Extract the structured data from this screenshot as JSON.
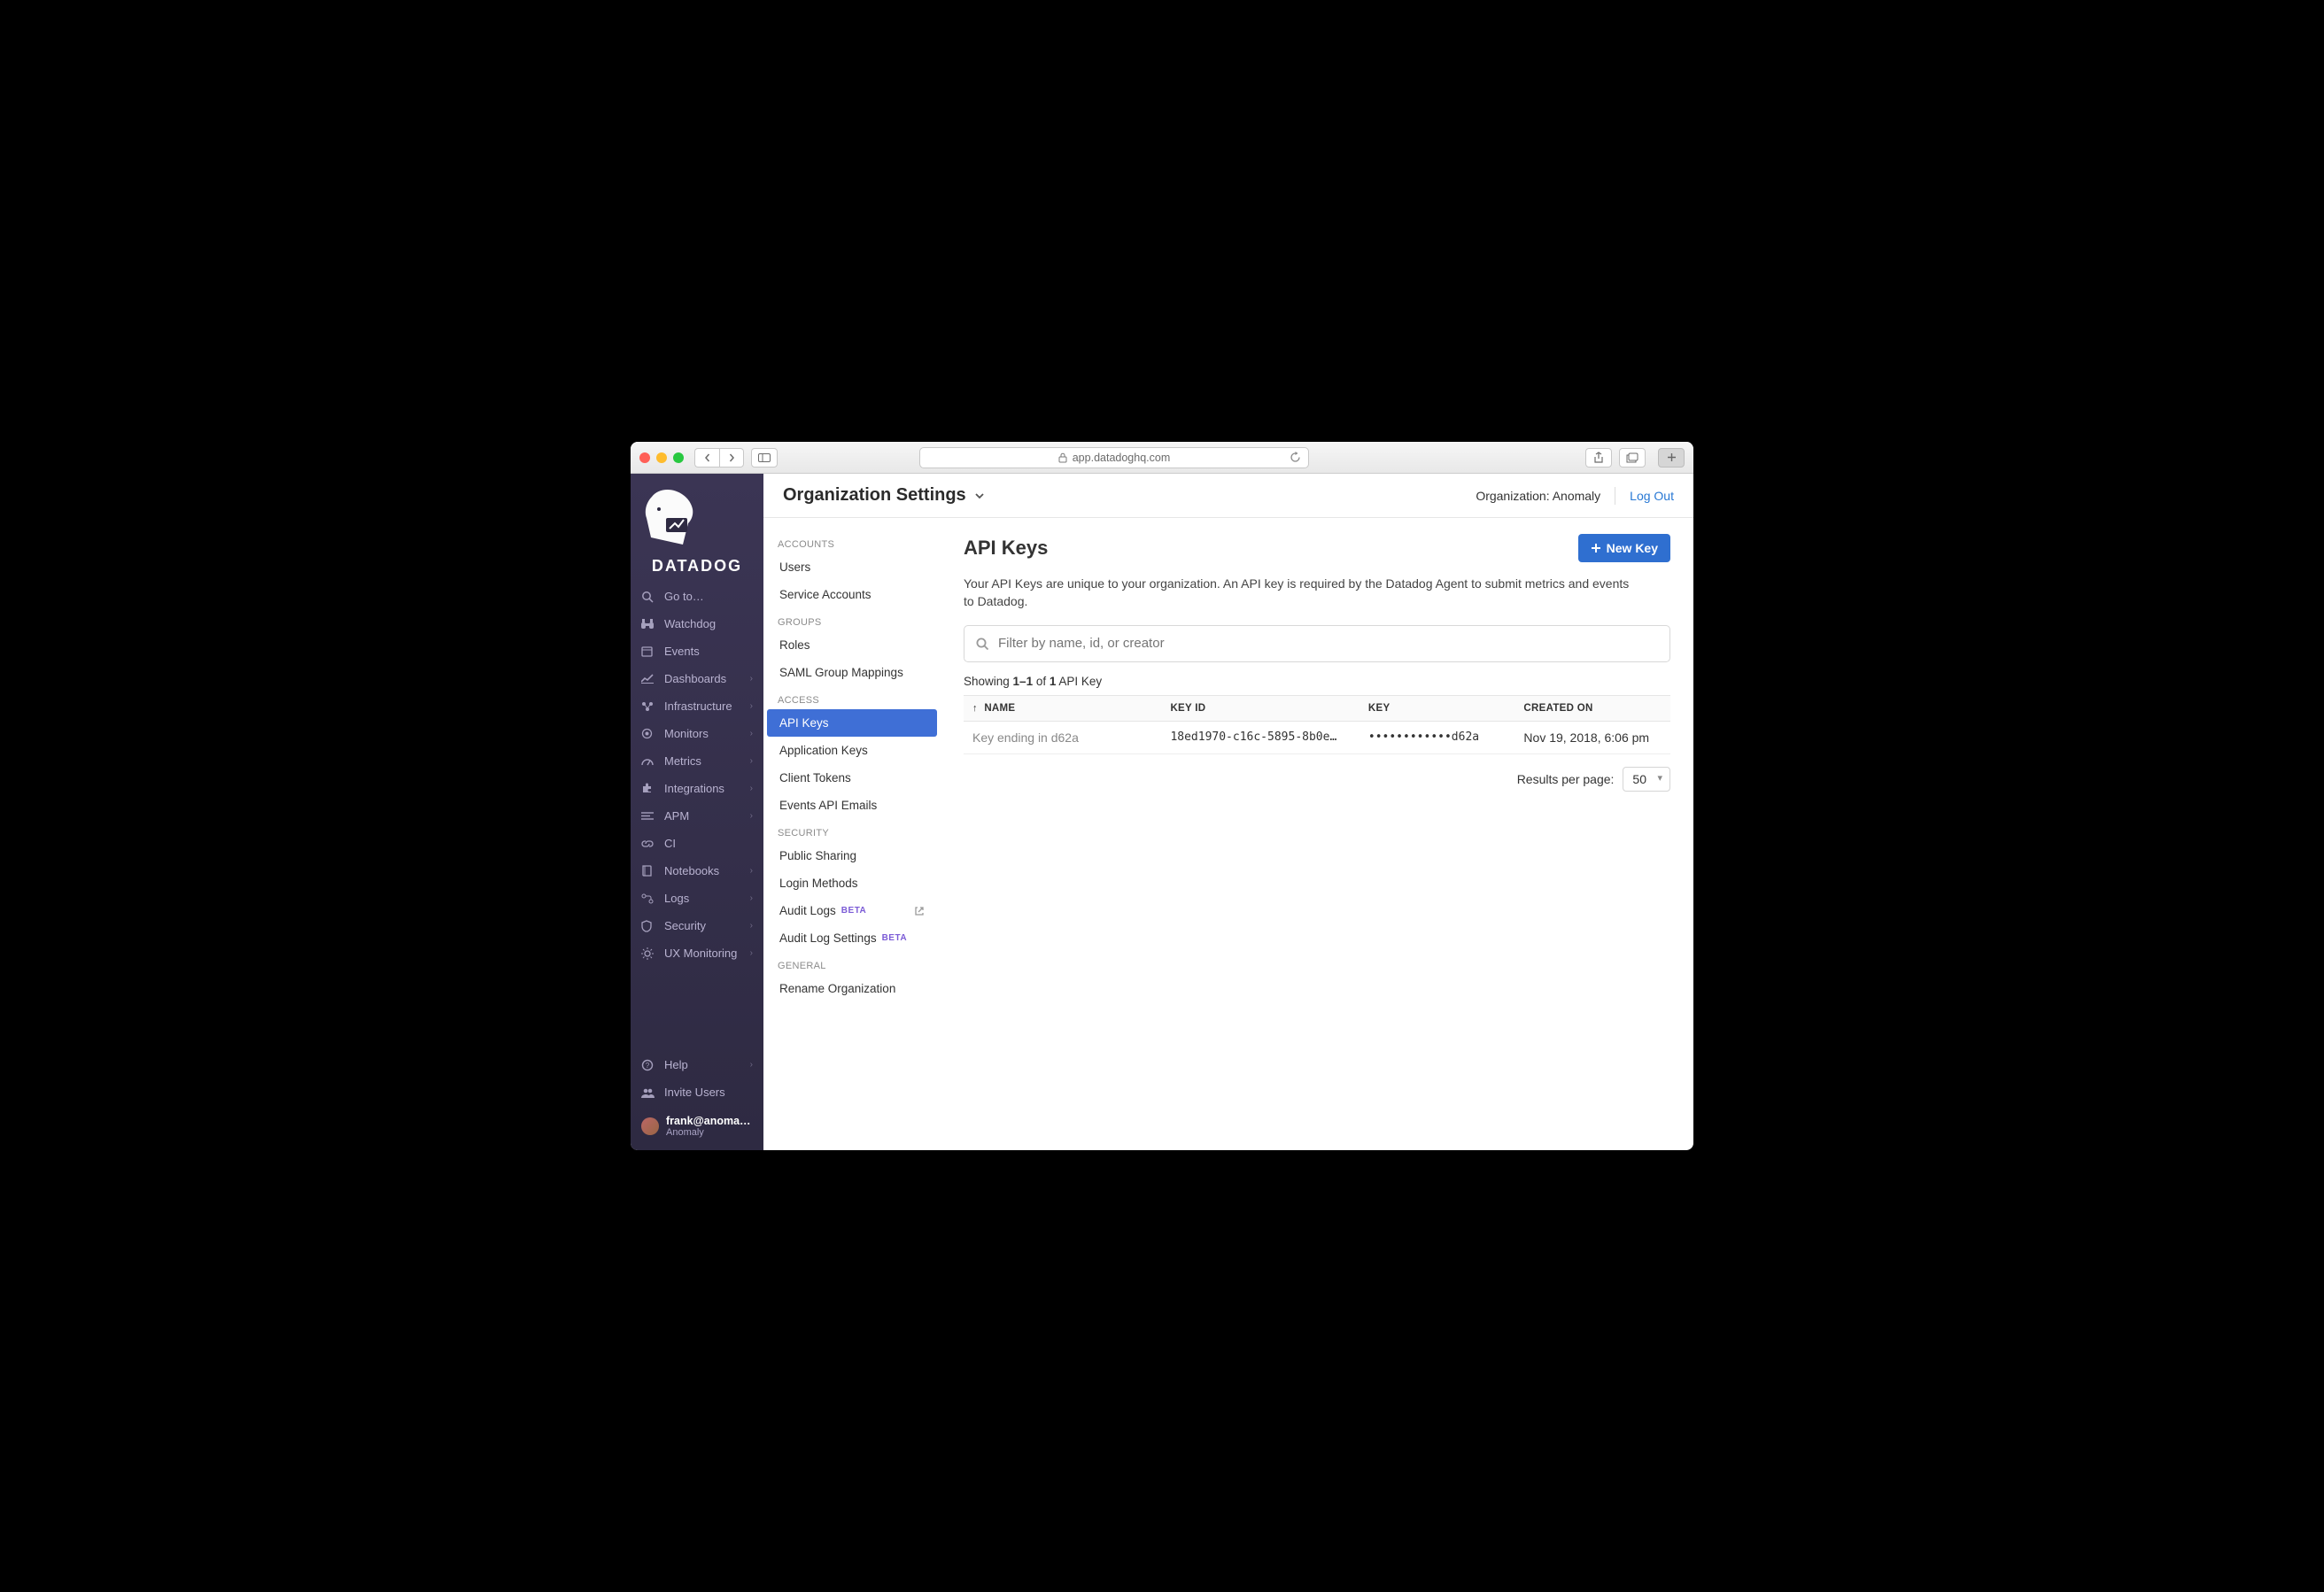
{
  "browser": {
    "url_host": "app.datadoghq.com"
  },
  "brand": "DATADOG",
  "leftnav": {
    "goto": "Go to…",
    "items": [
      {
        "icon": "binoculars",
        "label": "Watchdog",
        "chev": false
      },
      {
        "icon": "calendar",
        "label": "Events",
        "chev": false
      },
      {
        "icon": "chart",
        "label": "Dashboards",
        "chev": true
      },
      {
        "icon": "nodes",
        "label": "Infrastructure",
        "chev": true
      },
      {
        "icon": "target",
        "label": "Monitors",
        "chev": true
      },
      {
        "icon": "gauge",
        "label": "Metrics",
        "chev": true
      },
      {
        "icon": "puzzle",
        "label": "Integrations",
        "chev": true
      },
      {
        "icon": "lines",
        "label": "APM",
        "chev": true
      },
      {
        "icon": "link",
        "label": "CI",
        "chev": false
      },
      {
        "icon": "book",
        "label": "Notebooks",
        "chev": true
      },
      {
        "icon": "flow",
        "label": "Logs",
        "chev": true
      },
      {
        "icon": "shield",
        "label": "Security",
        "chev": true
      },
      {
        "icon": "ux",
        "label": "UX Monitoring",
        "chev": true
      }
    ],
    "help": "Help",
    "invite": "Invite Users",
    "user_email": "frank@anoma…",
    "user_org": "Anomaly"
  },
  "header": {
    "title": "Organization Settings",
    "org_label": "Organization: Anomaly",
    "logout": "Log Out"
  },
  "subnav": {
    "groups": [
      {
        "title": "ACCOUNTS",
        "items": [
          {
            "label": "Users"
          },
          {
            "label": "Service Accounts"
          }
        ]
      },
      {
        "title": "GROUPS",
        "items": [
          {
            "label": "Roles"
          },
          {
            "label": "SAML Group Mappings"
          }
        ]
      },
      {
        "title": "ACCESS",
        "items": [
          {
            "label": "API Keys",
            "active": true
          },
          {
            "label": "Application Keys"
          },
          {
            "label": "Client Tokens"
          },
          {
            "label": "Events API Emails"
          }
        ]
      },
      {
        "title": "SECURITY",
        "items": [
          {
            "label": "Public Sharing"
          },
          {
            "label": "Login Methods"
          },
          {
            "label": "Audit Logs",
            "badge": "BETA",
            "external": true
          },
          {
            "label": "Audit Log Settings",
            "badge": "BETA"
          }
        ]
      },
      {
        "title": "GENERAL",
        "items": [
          {
            "label": "Rename Organization"
          }
        ]
      }
    ]
  },
  "main": {
    "title": "API Keys",
    "new_button": "New Key",
    "description": "Your API Keys are unique to your organization. An API key is required by the Datadog Agent to submit metrics and events to Datadog.",
    "filter_placeholder": "Filter by name, id, or creator",
    "showing_prefix": "Showing ",
    "showing_range": "1–1",
    "showing_mid": " of ",
    "showing_total": "1",
    "showing_suffix": " API Key",
    "columns": {
      "name": "NAME",
      "key_id": "KEY ID",
      "key": "KEY",
      "created": "CREATED ON"
    },
    "rows": [
      {
        "name": "Key ending in d62a",
        "key_id": "18ed1970-c16c-5895-8b0e…",
        "key": "••••••••••••d62a",
        "created": "Nov 19, 2018, 6:06 pm"
      }
    ],
    "results_label": "Results per page:",
    "results_value": "50"
  }
}
